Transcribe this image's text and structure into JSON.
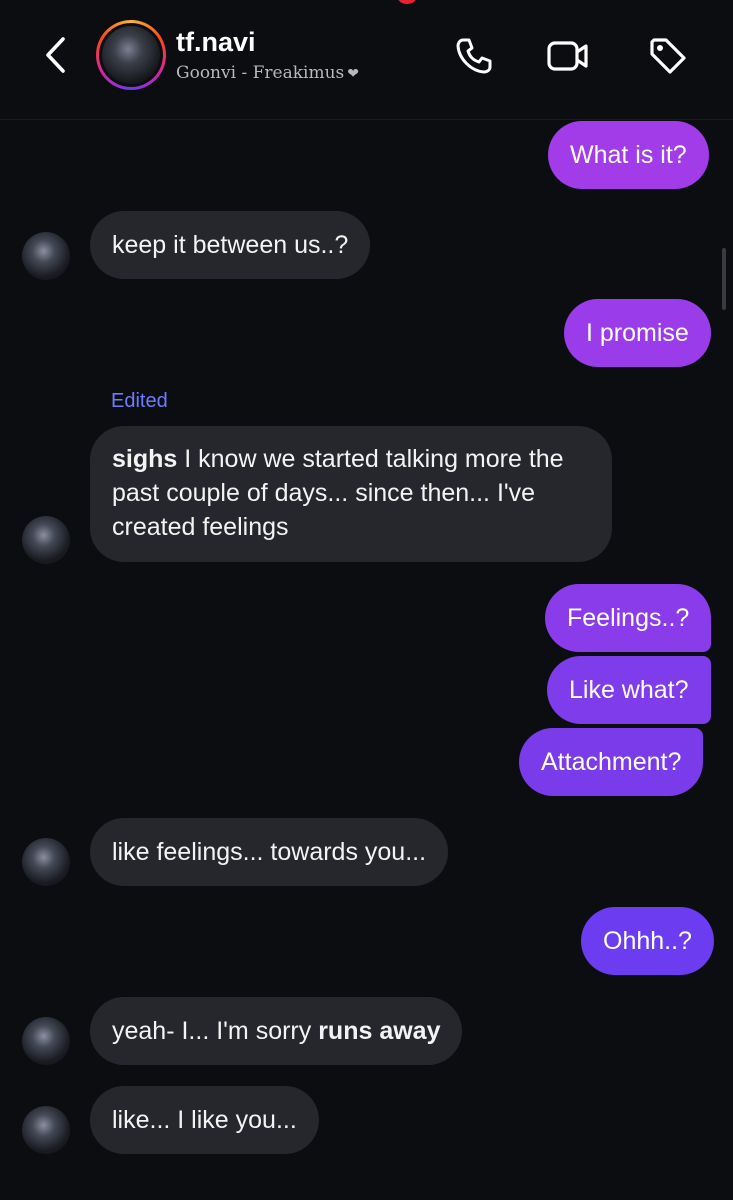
{
  "header": {
    "name": "tf.navi",
    "subtitle": "Goonvi - Freakimus",
    "heart": "❤",
    "icons": [
      "back-chevron-icon",
      "phone-icon",
      "video-camera-icon",
      "tag-icon"
    ]
  },
  "colors": {
    "background": "#0c0d11",
    "incoming_bubble": "#26272c",
    "outgoing_top": "#a23ce8",
    "outgoing_bottom": "#6a3cf0",
    "edited_label": "#6e7bff"
  },
  "edited_label": "Edited",
  "messages": [
    {
      "side": "out",
      "text": "What is it?"
    },
    {
      "side": "in",
      "text": "keep it between us..?"
    },
    {
      "side": "out",
      "text": "I promise"
    },
    {
      "side": "in",
      "bold": "sighs",
      "text": " I know we started talking more the past couple of days... since then... I've created feelings"
    },
    {
      "side": "out",
      "text": "Feelings..?"
    },
    {
      "side": "out",
      "text": "Like what?"
    },
    {
      "side": "out",
      "text": "Attachment?"
    },
    {
      "side": "in",
      "text": "like feelings... towards you..."
    },
    {
      "side": "out",
      "text": "Ohhh..?"
    },
    {
      "side": "in",
      "text": "yeah- I... I'm sorry ",
      "bold_end": "runs away"
    },
    {
      "side": "in",
      "text": "like... I like you..."
    }
  ]
}
